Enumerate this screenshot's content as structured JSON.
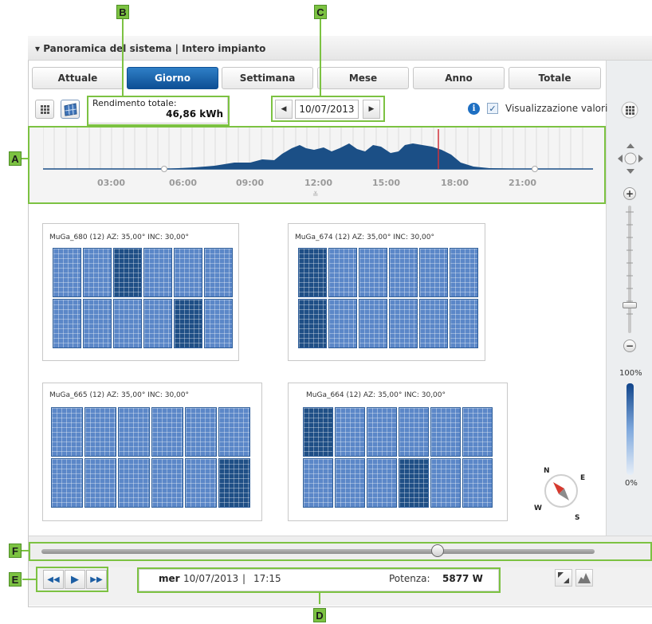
{
  "window": {
    "title": "▾ Panoramica del sistema | Intero impianto"
  },
  "tabs": [
    {
      "label": "Attuale",
      "active": false
    },
    {
      "label": "Giorno",
      "active": true
    },
    {
      "label": "Settimana",
      "active": false
    },
    {
      "label": "Mese",
      "active": false
    },
    {
      "label": "Anno",
      "active": false
    },
    {
      "label": "Totale",
      "active": false
    }
  ],
  "toolbar": {
    "rendimento_label": "Rendimento totale:",
    "rendimento_value": "46,86 kWh",
    "date": "10/07/2013",
    "prev_icon": "triangle-left-icon",
    "next_icon": "triangle-right-icon",
    "show_values_label": "Visualizzazione valori",
    "show_values_checked": true
  },
  "timeline": {
    "ticks": [
      "03:00",
      "06:00",
      "09:00",
      "12:00",
      "15:00",
      "18:00",
      "21:00"
    ],
    "area_color": "#1b4f86",
    "marker_color": "#d0303a"
  },
  "panels": [
    {
      "title": "MuGa_680 (12) AZ: 35,00° INC: 30,00°",
      "dark_modules": [
        2,
        10
      ]
    },
    {
      "title": "MuGa_674 (12) AZ: 35,00° INC: 30,00°",
      "dark_modules": [
        0,
        6
      ]
    },
    {
      "title": "MuGa_665 (12) AZ: 35,00° INC: 30,00°",
      "dark_modules": [
        11
      ]
    },
    {
      "title": "MuGa_664 (12) AZ: 35,00° INC: 30,00°",
      "dark_modules": [
        0,
        9
      ]
    }
  ],
  "compass": {
    "n": "N",
    "e": "E",
    "s": "S",
    "w": "W"
  },
  "legend": {
    "max": "100%",
    "min": "0%"
  },
  "timeslider": {
    "position": 0.7
  },
  "status": {
    "day": "mer",
    "date": "10/07/2013",
    "separator": "|",
    "time": "17:15",
    "power_label": "Potenza:",
    "power_value": "5877 W"
  },
  "callouts": [
    "A",
    "B",
    "C",
    "D",
    "E",
    "F"
  ],
  "colors": {
    "accent": "#7cc242",
    "tab_active": "#0d4f95",
    "module": "#5b87c8",
    "module_dark": "#1f4f86"
  }
}
